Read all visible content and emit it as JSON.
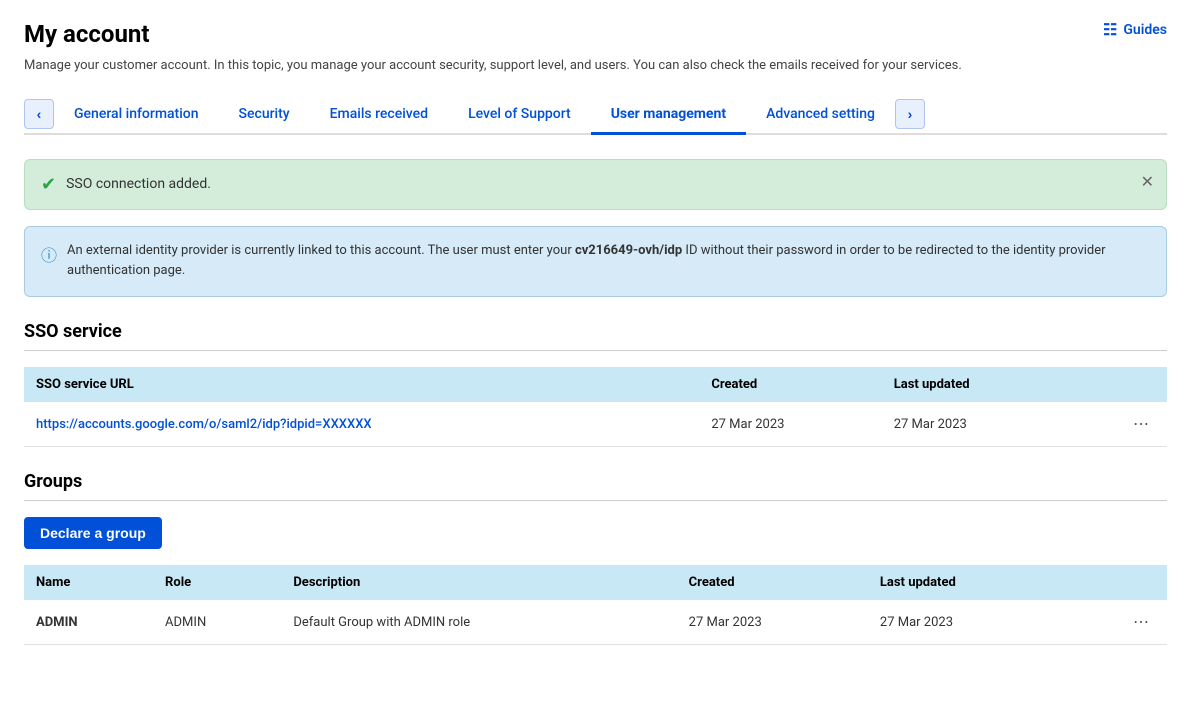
{
  "page": {
    "title": "My account",
    "subtitle": "Manage your customer account. In this topic, you manage your account security, support level, and users. You can also check the emails received for your services.",
    "guides_label": "Guides"
  },
  "tabs": [
    {
      "id": "general",
      "label": "General information",
      "active": false
    },
    {
      "id": "security",
      "label": "Security",
      "active": false
    },
    {
      "id": "emails",
      "label": "Emails received",
      "active": false
    },
    {
      "id": "support",
      "label": "Level of Support",
      "active": false
    },
    {
      "id": "user-management",
      "label": "User management",
      "active": true
    },
    {
      "id": "advanced",
      "label": "Advanced setting",
      "active": false
    }
  ],
  "alerts": {
    "success": {
      "text": "SSO connection added."
    },
    "info": {
      "text_before": "An external identity provider is currently linked to this account. The user must enter your ",
      "id": "cv216649-ovh/idp",
      "text_after": " ID without their password in order to be redirected to the identity provider authentication page."
    }
  },
  "sso_section": {
    "title": "SSO service",
    "table": {
      "headers": [
        "SSO service URL",
        "Created",
        "Last updated"
      ],
      "rows": [
        {
          "url": "https://accounts.google.com/o/saml2/idp?idpid=XXXXXX",
          "created": "27 Mar 2023",
          "last_updated": "27 Mar 2023"
        }
      ]
    }
  },
  "groups_section": {
    "title": "Groups",
    "declare_button": "Declare a group",
    "table": {
      "headers": [
        "Name",
        "Role",
        "Description",
        "Created",
        "Last updated"
      ],
      "rows": [
        {
          "name": "ADMIN",
          "role": "ADMIN",
          "description": "Default Group with ADMIN role",
          "created": "27 Mar 2023",
          "last_updated": "27 Mar 2023"
        }
      ]
    }
  }
}
